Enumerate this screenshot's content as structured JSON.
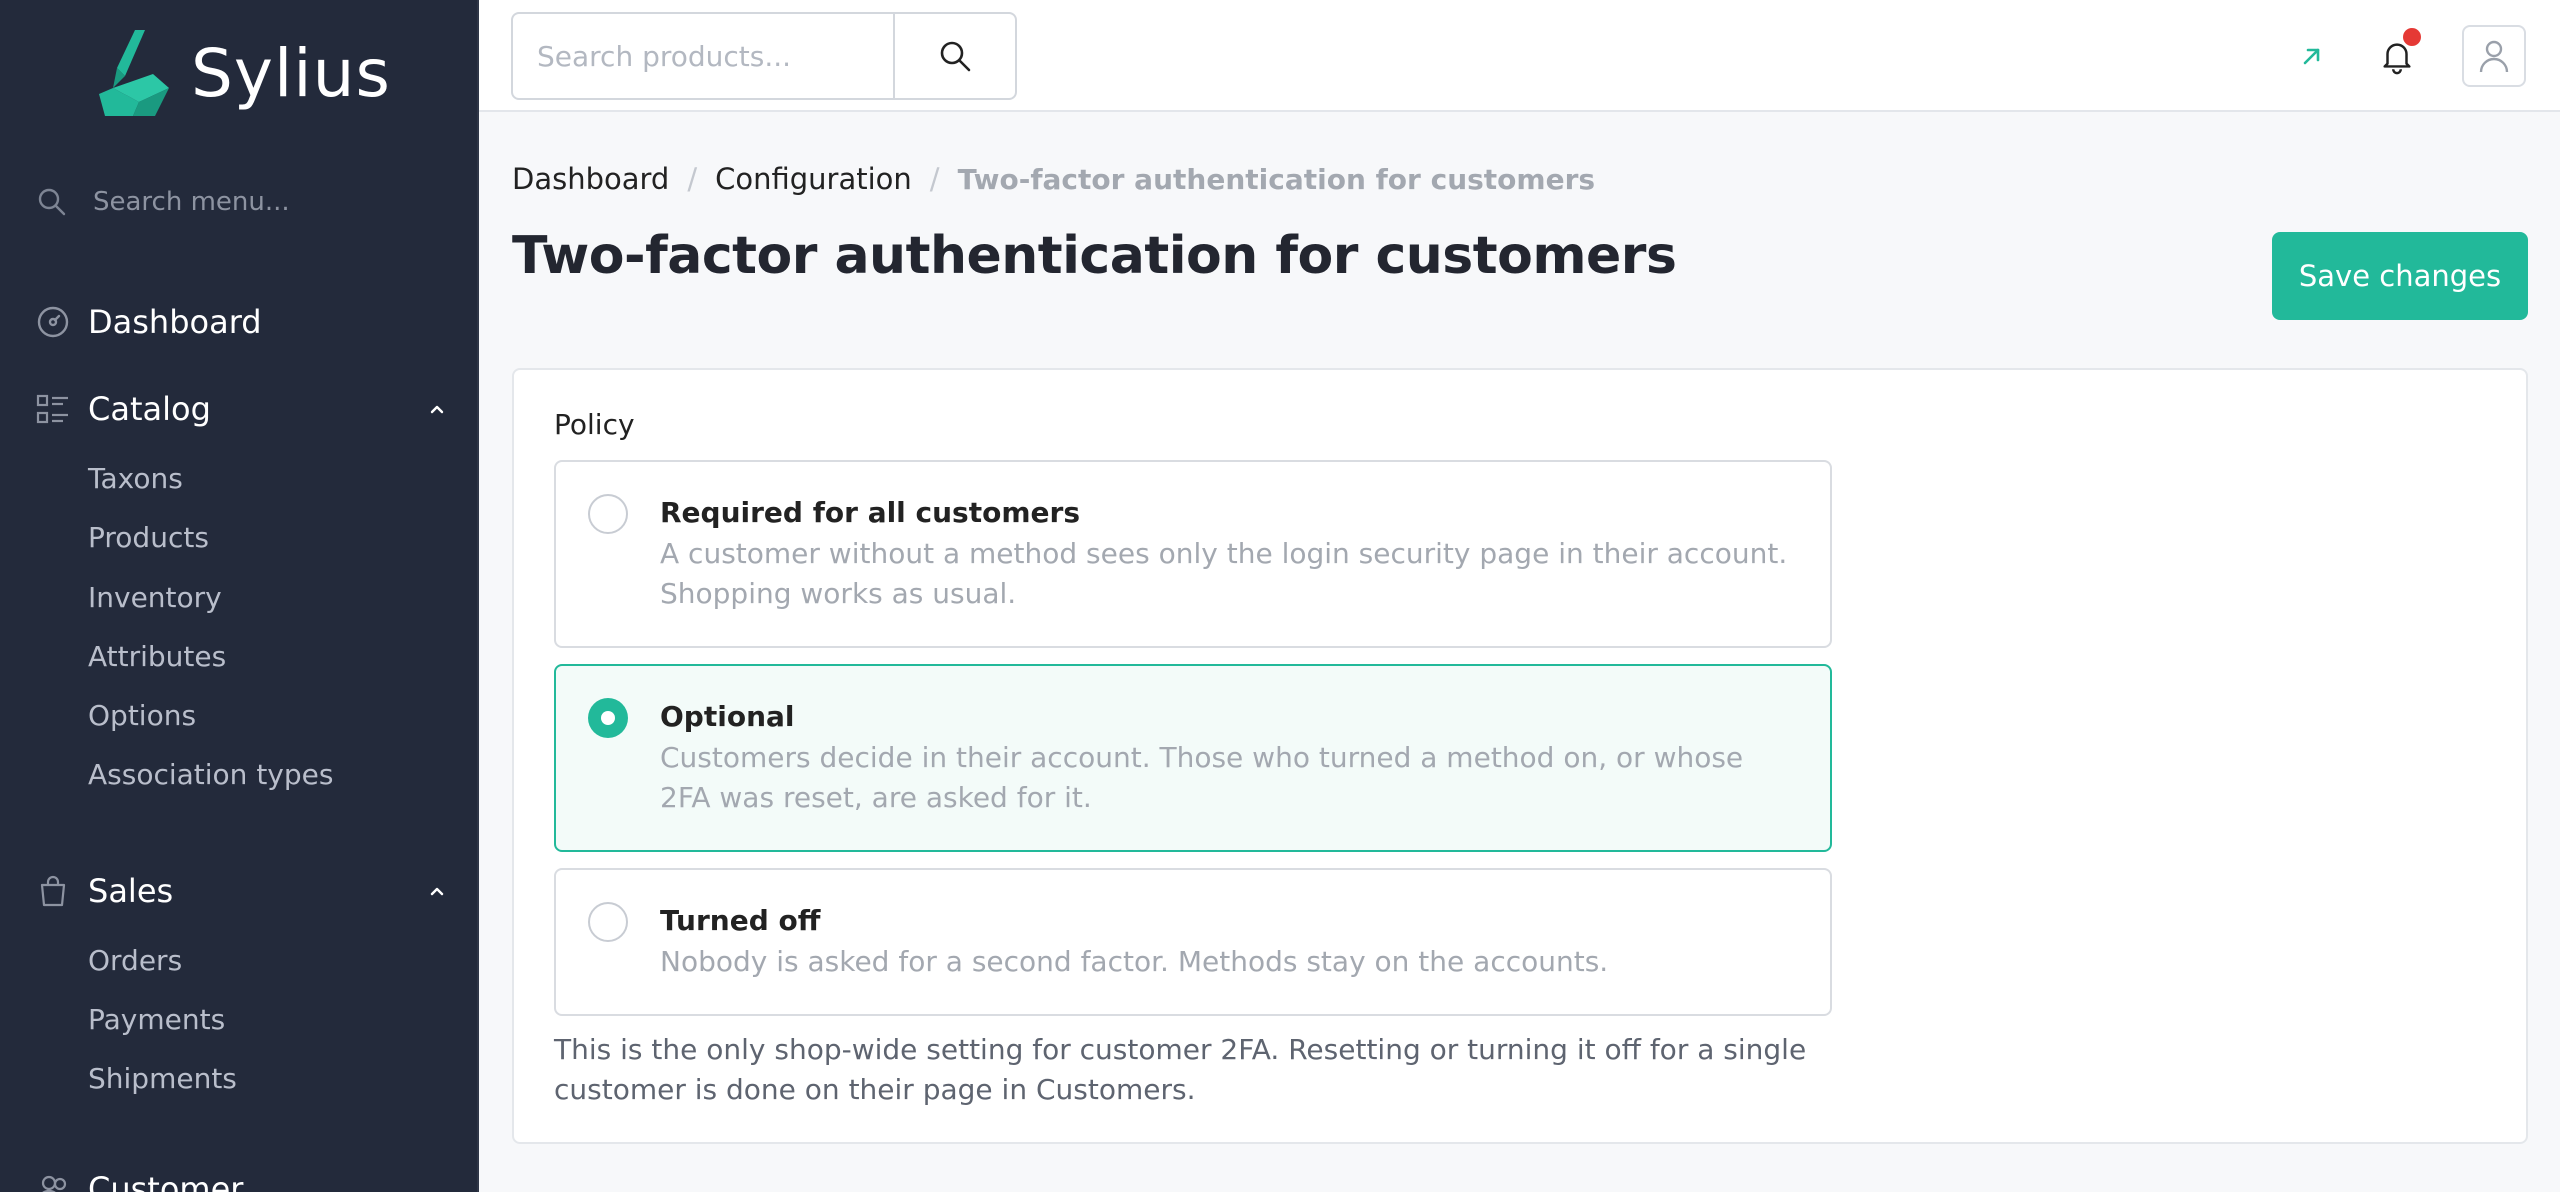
{
  "brand": {
    "name": "Sylius",
    "accent": "#22b99a"
  },
  "sidebar": {
    "search_placeholder": "Search menu...",
    "dashboard": {
      "label": "Dashboard",
      "icon": "dashboard-icon"
    },
    "catalog": {
      "label": "Catalog",
      "icon": "catalog-icon",
      "items": [
        "Taxons",
        "Products",
        "Inventory",
        "Attributes",
        "Options",
        "Association types"
      ]
    },
    "sales": {
      "label": "Sales",
      "icon": "shopping-bag-icon",
      "items": [
        "Orders",
        "Payments",
        "Shipments"
      ]
    },
    "customers": {
      "label": "Customer",
      "icon": "users-icon"
    }
  },
  "topbar": {
    "search_placeholder": "Search products...",
    "icons": [
      "search-icon",
      "external-link-icon",
      "bell-icon",
      "user-icon"
    ],
    "has_notification": true
  },
  "breadcrumb": {
    "items": [
      "Dashboard",
      "Configuration"
    ],
    "current": "Two-factor authentication for customers",
    "separator": "/"
  },
  "page": {
    "title": "Two-factor authentication for customers",
    "save_label": "Save changes"
  },
  "policy": {
    "label": "Policy",
    "selected": "optional",
    "options": [
      {
        "id": "required",
        "title": "Required for all customers",
        "description": "A customer without a method sees only the login security page in their account. Shopping works as usual."
      },
      {
        "id": "optional",
        "title": "Optional",
        "description": "Customers decide in their account. Those who turned a method on, or whose 2FA was reset, are asked for it."
      },
      {
        "id": "off",
        "title": "Turned off",
        "description": "Nobody is asked for a second factor. Methods stay on the accounts."
      }
    ],
    "help": "This is the only shop-wide setting for customer 2FA. Resetting or turning it off for a single customer is done on their page in Customers."
  }
}
